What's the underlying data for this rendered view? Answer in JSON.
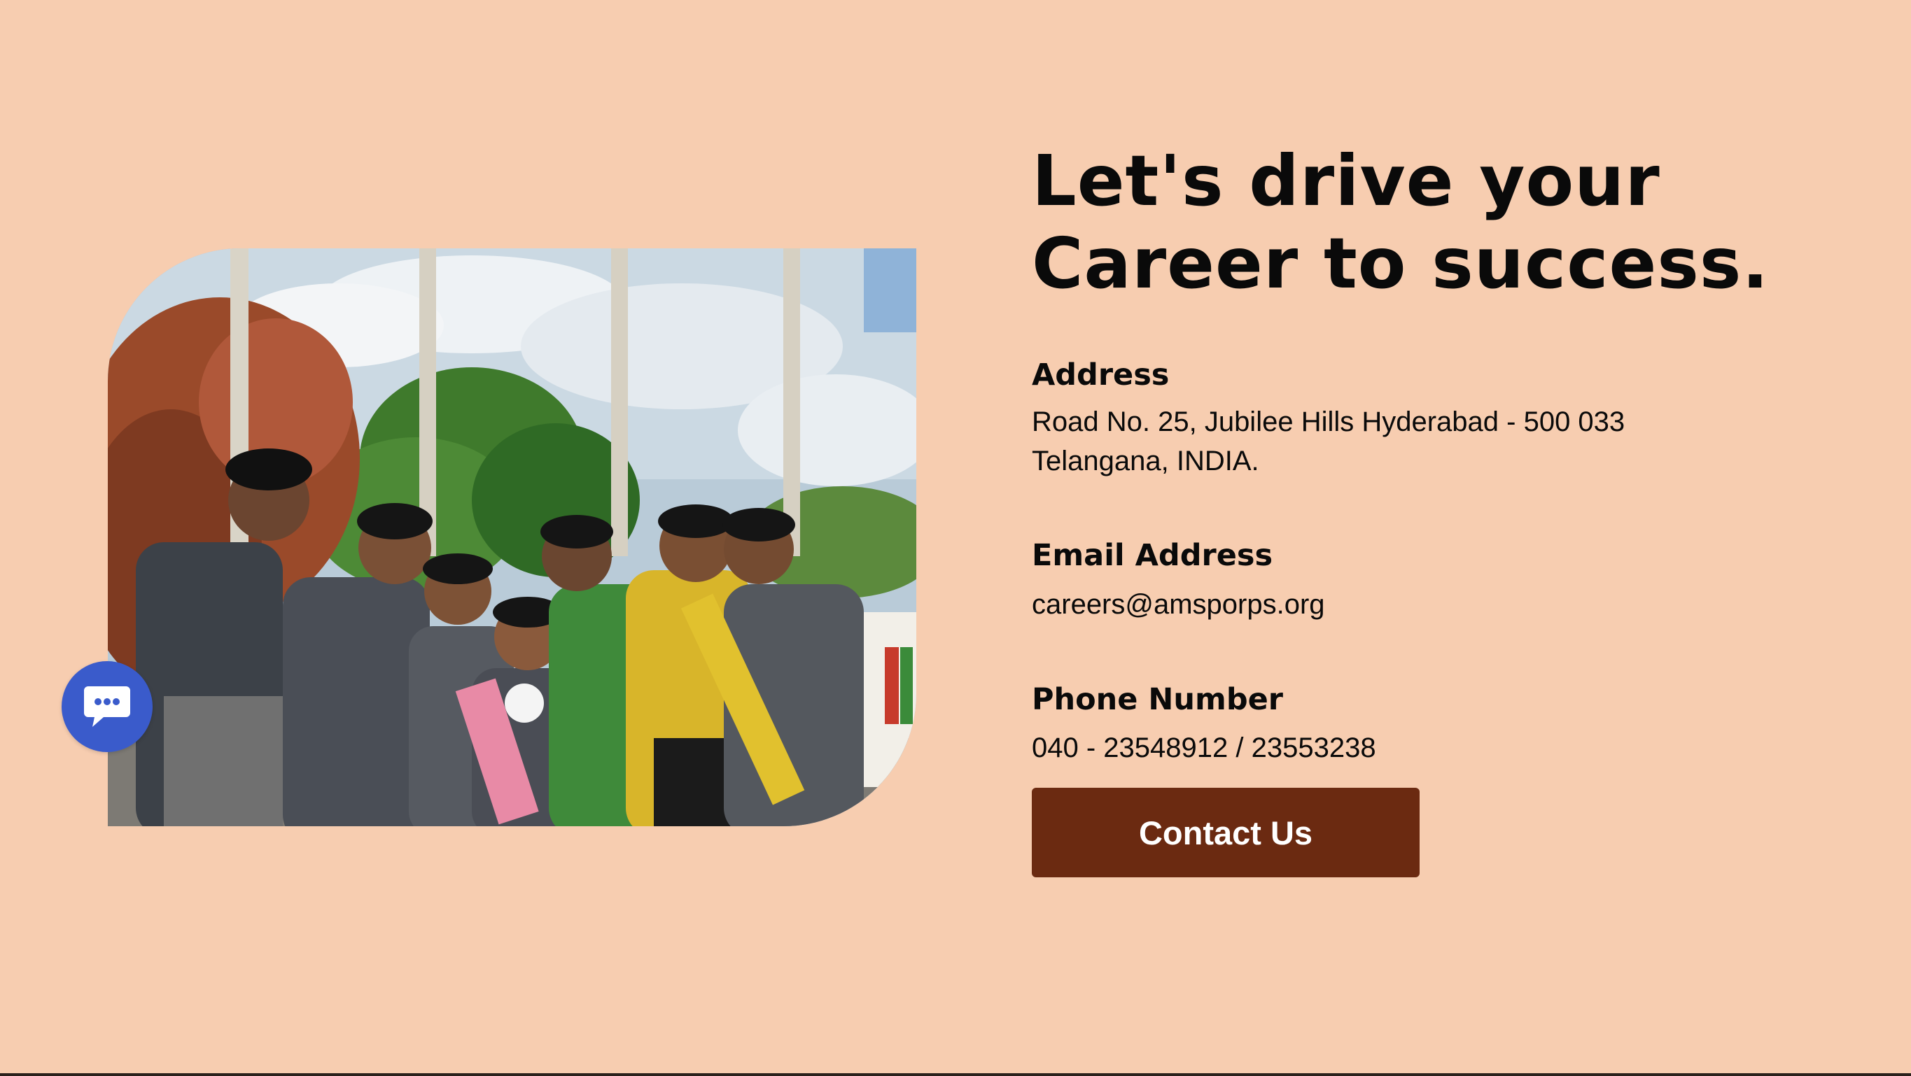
{
  "headline": {
    "line1": "Let's drive your",
    "line2": "Career to success."
  },
  "address": {
    "label": "Address",
    "line1": "Road No. 25, Jubilee Hills Hyderabad - 500 033",
    "line2": "Telangana, INDIA."
  },
  "email": {
    "label": "Email Address",
    "value": "careers@amsporps.org"
  },
  "phone": {
    "label": "Phone Number",
    "value": "040 - 23548912 / 23553238"
  },
  "cta": {
    "label": "Contact Us"
  },
  "chat": {
    "icon": "chat-bubble-icon"
  },
  "colors": {
    "background": "#f7cdb0",
    "button": "#6b2a11",
    "chat": "#3a5bcb",
    "text": "#0a0a0a"
  }
}
